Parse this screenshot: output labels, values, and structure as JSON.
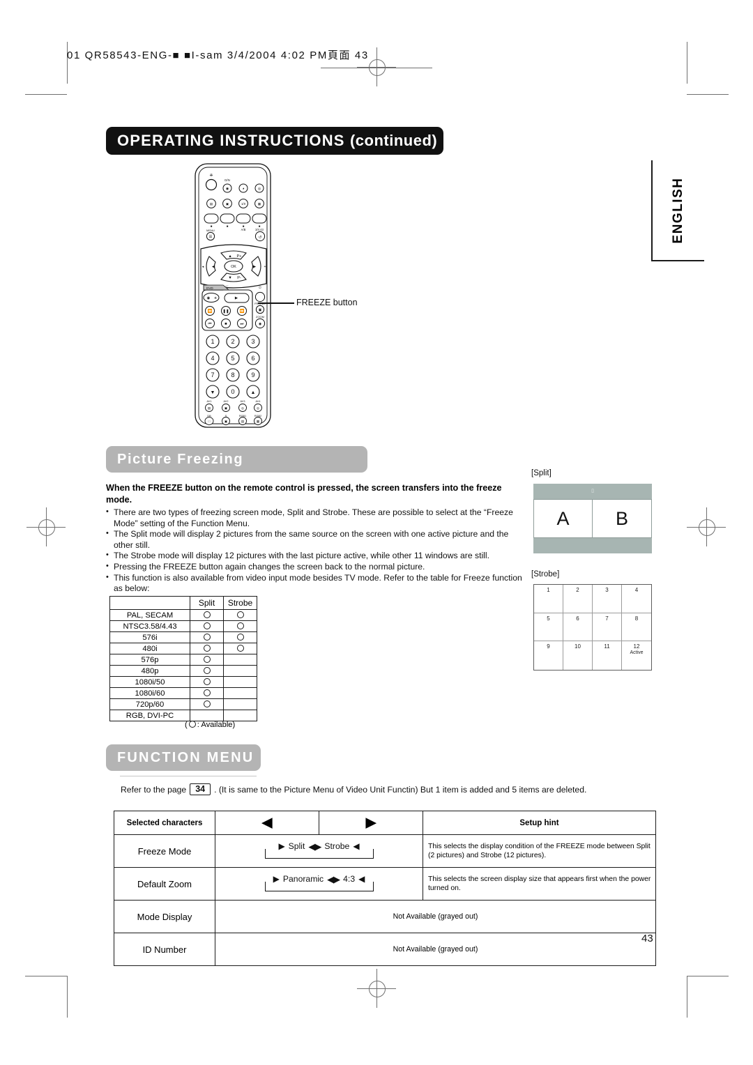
{
  "print_marks": {
    "file_stamp": "01 QR58543-ENG-■ ■I-sam 3/4/2004 4:02 PM頁面 43"
  },
  "header": {
    "title_main": "OPERATING INSTRUCTIONS",
    "title_suffix": "(continued)"
  },
  "language_tab": {
    "label": "ENGLISH"
  },
  "remote": {
    "callout_label": "FREEZE button",
    "dvd_label": "DVD",
    "freeze_label": "FREEZE",
    "zoom_label": "ZOOM",
    "ok_label": "OK",
    "menu_label": "MENU",
    "ch_up_label": "P+",
    "ch_down_label": "P-",
    "dn_label": "D/N",
    "ab_label": "A/B",
    "dual_label": "3/4.43",
    "numbers": [
      "1",
      "2",
      "3",
      "4",
      "5",
      "6",
      "7",
      "8",
      "9",
      "0"
    ],
    "bottom_row1": [
      "AV1",
      "AV2",
      "AV3",
      "AV4"
    ],
    "bottom_row2": [
      "DB",
      "S",
      "RGB1",
      "RGB2"
    ]
  },
  "picture_freezing": {
    "section_title": "Picture Freezing",
    "lead": "When the FREEZE button on the remote control is pressed, the screen transfers into the freeze mode.",
    "bullets": [
      "There are two types of freezing screen mode, Split and Strobe. These are possible to select at the “Freeze Mode” setting of the Function Menu.",
      "The Split mode will display 2 pictures from the same source on the screen with one active picture and the other still.",
      "The Strobe mode will display 12 pictures with the last picture active, while other 11 windows are still.",
      "Pressing the FREEZE button again changes the screen back to the normal picture.",
      "This function is also available from video input mode besides TV mode. Refer to the table for Freeze function as below:"
    ]
  },
  "availability_table": {
    "columns": [
      "",
      "Split",
      "Strobe"
    ],
    "rows": [
      {
        "mode": "PAL, SECAM",
        "split": true,
        "strobe": true
      },
      {
        "mode": "NTSC3.58/4.43",
        "split": true,
        "strobe": true
      },
      {
        "mode": "576i",
        "split": true,
        "strobe": true
      },
      {
        "mode": "480i",
        "split": true,
        "strobe": true
      },
      {
        "mode": "576p",
        "split": true,
        "strobe": false
      },
      {
        "mode": "480p",
        "split": true,
        "strobe": false
      },
      {
        "mode": "1080i/50",
        "split": true,
        "strobe": false
      },
      {
        "mode": "1080i/60",
        "split": true,
        "strobe": false
      },
      {
        "mode": "720p/60",
        "split": true,
        "strobe": false
      },
      {
        "mode": "RGB, DVI-PC",
        "split": false,
        "strobe": false
      }
    ],
    "legend_prefix": "(",
    "legend_text": ": Available)"
  },
  "split_diagram": {
    "label": "[Split]",
    "tiny_mark": "▯",
    "panes": [
      "A",
      "B"
    ],
    "background_color": "#a7b5b2"
  },
  "strobe_diagram": {
    "label": "[Strobe]",
    "cells": [
      {
        "n": "1",
        "note": ""
      },
      {
        "n": "2",
        "note": ""
      },
      {
        "n": "3",
        "note": ""
      },
      {
        "n": "4",
        "note": ""
      },
      {
        "n": "5",
        "note": ""
      },
      {
        "n": "6",
        "note": ""
      },
      {
        "n": "7",
        "note": ""
      },
      {
        "n": "8",
        "note": ""
      },
      {
        "n": "9",
        "note": ""
      },
      {
        "n": "10",
        "note": ""
      },
      {
        "n": "11",
        "note": ""
      },
      {
        "n": "12",
        "note": "Active"
      }
    ]
  },
  "function_menu": {
    "section_title": "FUNCTION MENU",
    "refer_prefix": "Refer to the page",
    "refer_page": "34",
    "refer_suffix": ". (It is same to the Picture Menu of Video Unit Functin) But 1 item is added and 5 items are deleted.",
    "table": {
      "headers": {
        "selected": "Selected characters",
        "left_arrow": "◀",
        "right_arrow": "▶",
        "hint": "Setup hint"
      },
      "rows": [
        {
          "label": "Freeze Mode",
          "cycle": [
            "Split",
            "Strobe"
          ],
          "hint": "This selects the display condition of the FREEZE mode between Split (2 pictures) and Strobe (12 pictures)."
        },
        {
          "label": "Default Zoom",
          "cycle": [
            "Panoramic",
            "4:3"
          ],
          "hint": "This selects the screen  display size that appears first when the power turned on."
        },
        {
          "label": "Mode Display",
          "cycle": null,
          "hint": "Not Available (grayed out)"
        },
        {
          "label": "ID Number",
          "cycle": null,
          "hint": "Not Available (grayed out)"
        }
      ]
    }
  },
  "footer": {
    "page_number": "43"
  },
  "colors": {
    "title_bar": "#111111",
    "section_head": "#b4b4b4",
    "split_bg": "#a7b5b2",
    "rule": "#c6c6c6"
  }
}
